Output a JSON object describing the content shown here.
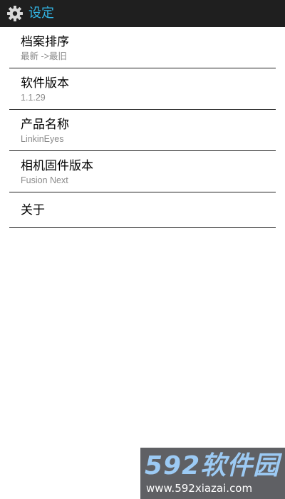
{
  "app_bar": {
    "title": "设定",
    "icon": "gear-icon",
    "title_color": "#33b5e5",
    "background": "#1f1f1f"
  },
  "settings": {
    "items": [
      {
        "title": "档案排序",
        "subtitle": "最新 ->最旧"
      },
      {
        "title": "软件版本",
        "subtitle": "1.1.29"
      },
      {
        "title": "产品名称",
        "subtitle": "LinkinEyes"
      },
      {
        "title": "相机固件版本",
        "subtitle": "Fusion Next"
      },
      {
        "title": "关于"
      }
    ]
  },
  "watermark": {
    "logo": "592软件园",
    "url": "www.592xiazai.com"
  }
}
